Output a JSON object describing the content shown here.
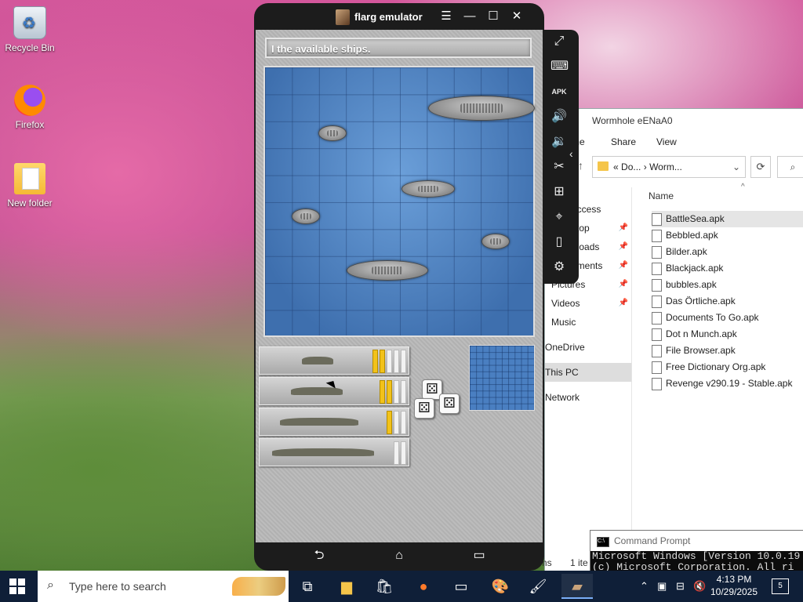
{
  "desktop": {
    "icons": [
      {
        "label": "Recycle Bin"
      },
      {
        "label": "Firefox"
      },
      {
        "label": "New folder"
      }
    ]
  },
  "emulator": {
    "title": "flarg emulator",
    "controls": {
      "menu": "☰",
      "minimize": "—",
      "maximize": "☐",
      "close": "✕"
    },
    "game": {
      "prompt": "I the available ships.",
      "fleet": [
        {
          "filled": 2,
          "total": 5
        },
        {
          "filled": 2,
          "total": 4
        },
        {
          "filled": 1,
          "total": 3
        },
        {
          "filled": 0,
          "total": 2
        }
      ]
    },
    "nav": {
      "back": "⮌",
      "home": "⌂",
      "recents": "▭"
    },
    "side_tools": [
      "fullscreen-icon",
      "keyboard-icon",
      "apk-icon",
      "volume-up-icon",
      "volume-down-icon",
      "scissors-icon",
      "add-icon",
      "location-icon",
      "shake-icon",
      "settings-icon"
    ]
  },
  "explorer": {
    "title": "Wormhole eENaA0",
    "menu": [
      "me",
      "Share",
      "View"
    ],
    "address": {
      "prefix": "«",
      "path1": "Do...",
      "sep": "›",
      "path2": "Worm..."
    },
    "nav_pane": [
      {
        "label": "access",
        "pinned": false
      },
      {
        "label": "ktop",
        "pinned": true
      },
      {
        "label": "nloads",
        "pinned": true
      },
      {
        "label": "uments",
        "pinned": true
      },
      {
        "label": "Pictures",
        "pinned": true
      },
      {
        "label": "Videos",
        "pinned": true
      },
      {
        "label": "Music",
        "pinned": false
      },
      {
        "label": "OneDrive",
        "pinned": false
      },
      {
        "label": "This PC",
        "pinned": false,
        "selected": true
      },
      {
        "label": "Network",
        "pinned": false
      }
    ],
    "column_header": "Name",
    "files": [
      "BattleSea.apk",
      "Bebbled.apk",
      "Bilder.apk",
      "Blackjack.apk",
      "bubbles.apk",
      "Das Örtliche.apk",
      "Documents To Go.apk",
      "Dot n Munch.apk",
      "File Browser.apk",
      "Free Dictionary Org.apk",
      "Revenge v290.19 - Stable.apk"
    ],
    "status_left": "ems",
    "status_right": "1 ite"
  },
  "cmd": {
    "title": "Command Prompt",
    "line1": "Microsoft Windows [Version 10.0.19",
    "line2": "(c) Microsoft Corporation. All ri"
  },
  "taskbar": {
    "search_placeholder": "Type here to search",
    "time": "4:13 PM",
    "date": "10/29/2025",
    "notification_count": "5"
  }
}
